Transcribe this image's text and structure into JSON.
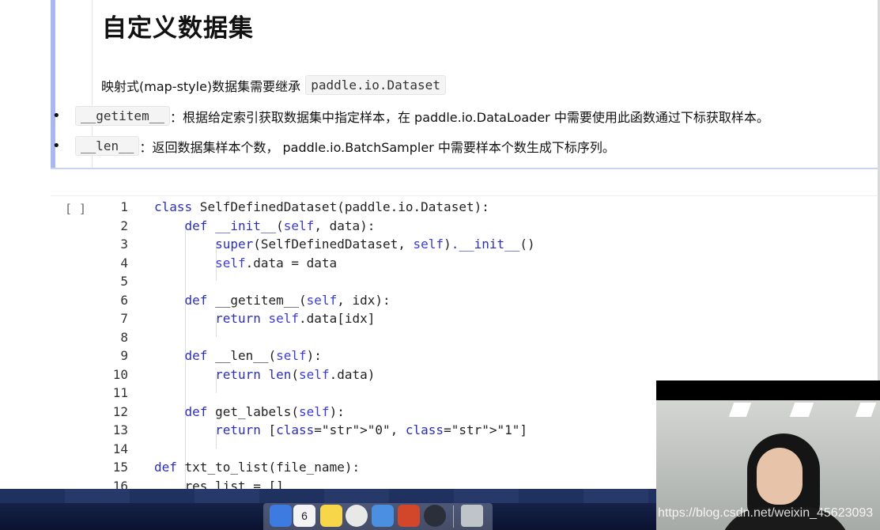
{
  "markdown_cell": {
    "title": "自定义数据集",
    "intro_text": "映射式(map-style)数据集需要继承",
    "intro_code": "paddle.io.Dataset",
    "bullets": [
      {
        "code": "__getitem__",
        "text": "：根据给定索引获取数据集中指定样本，在 paddle.io.DataLoader 中需要使用此函数通过下标获取样本。"
      },
      {
        "code": "__len__",
        "text": "：返回数据集样本个数， paddle.io.BatchSampler 中需要样本个数生成下标序列。"
      }
    ],
    "bullet_char": "•"
  },
  "code_cell": {
    "prompt": "[ ]",
    "lines": [
      {
        "n": "1",
        "text": "class SelfDefinedDataset(paddle.io.Dataset):"
      },
      {
        "n": "2",
        "text": "    def __init__(self, data):"
      },
      {
        "n": "3",
        "text": "        super(SelfDefinedDataset, self).__init__()"
      },
      {
        "n": "4",
        "text": "        self.data = data"
      },
      {
        "n": "5",
        "text": ""
      },
      {
        "n": "6",
        "text": "    def __getitem__(self, idx):"
      },
      {
        "n": "7",
        "text": "        return self.data[idx]"
      },
      {
        "n": "8",
        "text": ""
      },
      {
        "n": "9",
        "text": "    def __len__(self):"
      },
      {
        "n": "10",
        "text": "        return len(self.data)"
      },
      {
        "n": "11",
        "text": ""
      },
      {
        "n": "12",
        "text": "    def get_labels(self):"
      },
      {
        "n": "13",
        "text": "        return [\"0\", \"1\"]"
      },
      {
        "n": "14",
        "text": ""
      },
      {
        "n": "15",
        "text": "def txt_to_list(file_name):"
      },
      {
        "n": "16",
        "text": "    res_list = []"
      }
    ]
  },
  "watermark": "https://blog.csdn.net/weixin_45623093",
  "dock": {
    "icons": [
      "finder-icon",
      "calendar-icon",
      "notes-icon",
      "chrome-icon",
      "tasks-icon",
      "powerpoint-icon",
      "obs-icon",
      "trash-icon"
    ],
    "calendar_day": "6",
    "icon_colors": [
      "#3d7be0",
      "#f3f3f3",
      "#f7d64a",
      "#e8e8e8",
      "#4a8fe0",
      "#d2472a",
      "#2b2f3a",
      "#bfc4c9"
    ]
  },
  "colors": {
    "keyword": "#2b2fb5",
    "string": "#b0202a",
    "cell_accent": "#a9b9ef"
  }
}
